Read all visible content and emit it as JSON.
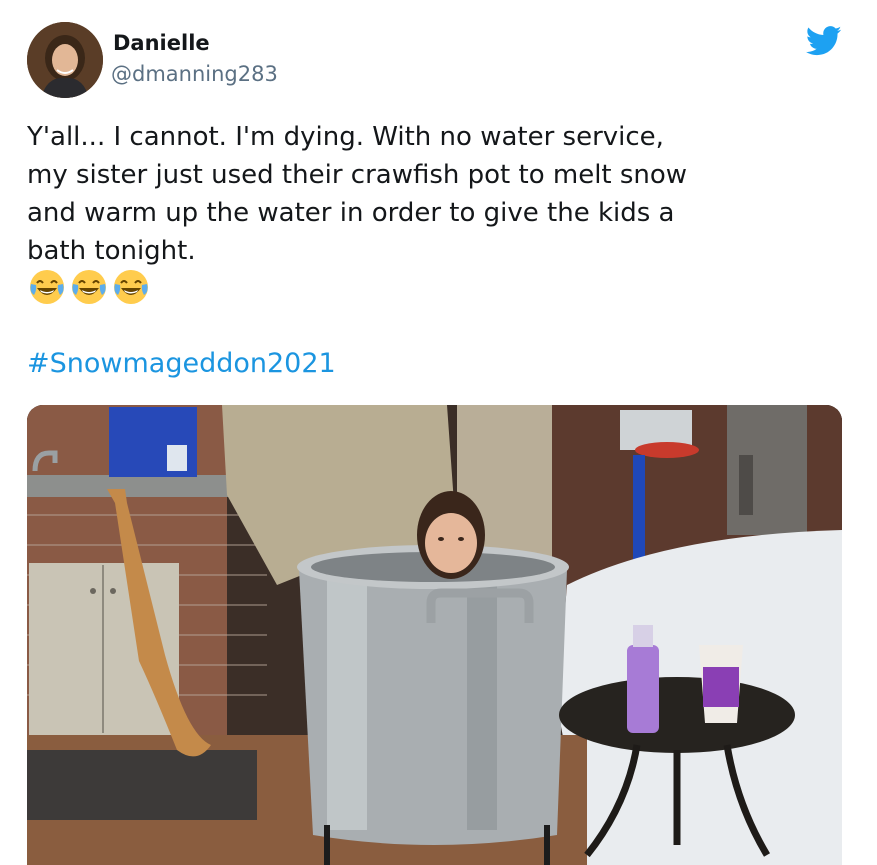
{
  "tweet": {
    "display_name": "Danielle",
    "handle": "@dmanning283",
    "text": "Y'all... I cannot. I'm dying. With no water service,\nmy sister just used their crawfish pot to melt snow\nand warm up the water in order to give the kids a\nbath tonight.",
    "emojis": [
      "face-with-tears-of-joy",
      "face-with-tears-of-joy",
      "face-with-tears-of-joy"
    ],
    "hashtag": "#Snowmageddon2021"
  },
  "colors": {
    "twitter_blue": "#1da1f2",
    "link_blue": "#1b95e0",
    "handle_gray": "#5b7083",
    "text": "#14171a"
  },
  "icons": [
    "twitter-bird-icon"
  ]
}
